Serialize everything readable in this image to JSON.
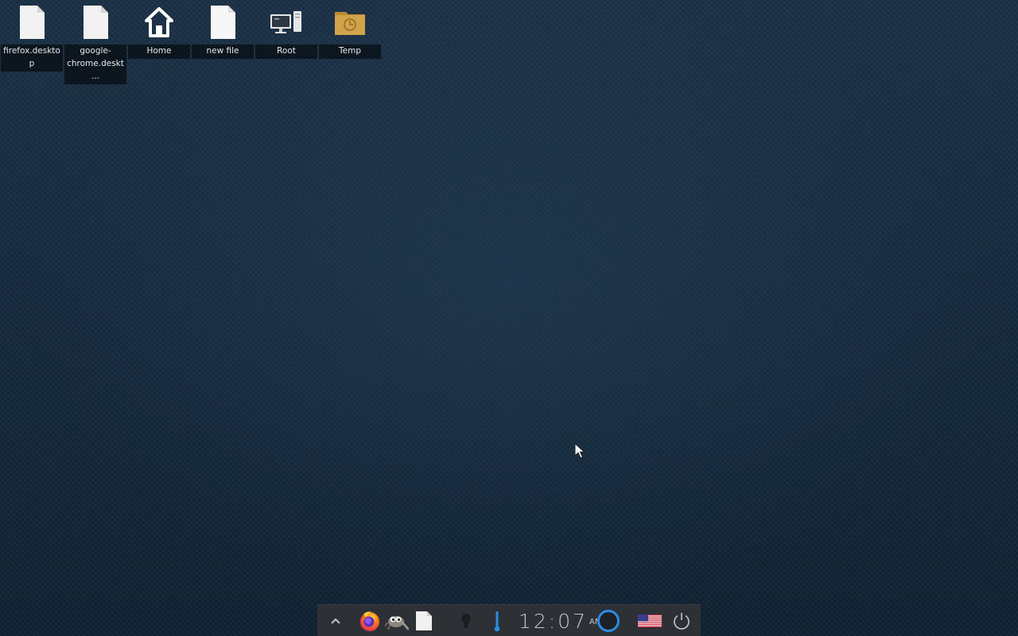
{
  "desktop": {
    "icons": [
      {
        "label": "firefox.desktop",
        "icon": "document-icon"
      },
      {
        "label": "google-chrome.deskt...",
        "icon": "document-icon"
      },
      {
        "label": "Home",
        "icon": "home-icon"
      },
      {
        "label": "new file",
        "icon": "document-icon"
      },
      {
        "label": "Root",
        "icon": "computer-icon"
      },
      {
        "label": "Temp",
        "icon": "folder-clock-icon"
      }
    ]
  },
  "panel": {
    "items": [
      {
        "name": "show-hidden-tray-arrow",
        "icon": "chevron-up-icon"
      },
      {
        "name": "firefox-launcher",
        "icon": "firefox-icon"
      },
      {
        "name": "gimp-launcher",
        "icon": "gimp-icon"
      },
      {
        "name": "text-editor-launcher",
        "icon": "document-icon"
      },
      {
        "name": "notifications-indicator",
        "icon": "lightbulb-icon"
      },
      {
        "name": "temperature-indicator",
        "icon": "thermometer-icon"
      },
      {
        "name": "activity-indicator",
        "icon": "ring-icon"
      },
      {
        "name": "keyboard-layout",
        "icon": "us-flag-icon"
      },
      {
        "name": "power-button",
        "icon": "power-icon"
      }
    ],
    "clock": {
      "time": "12:07",
      "ampm": "AM"
    }
  },
  "colors": {
    "wallpaper": "#17293b",
    "panel": "#2d3136",
    "accent_blue": "#2a8ee6",
    "folder": "#c99a3c"
  }
}
